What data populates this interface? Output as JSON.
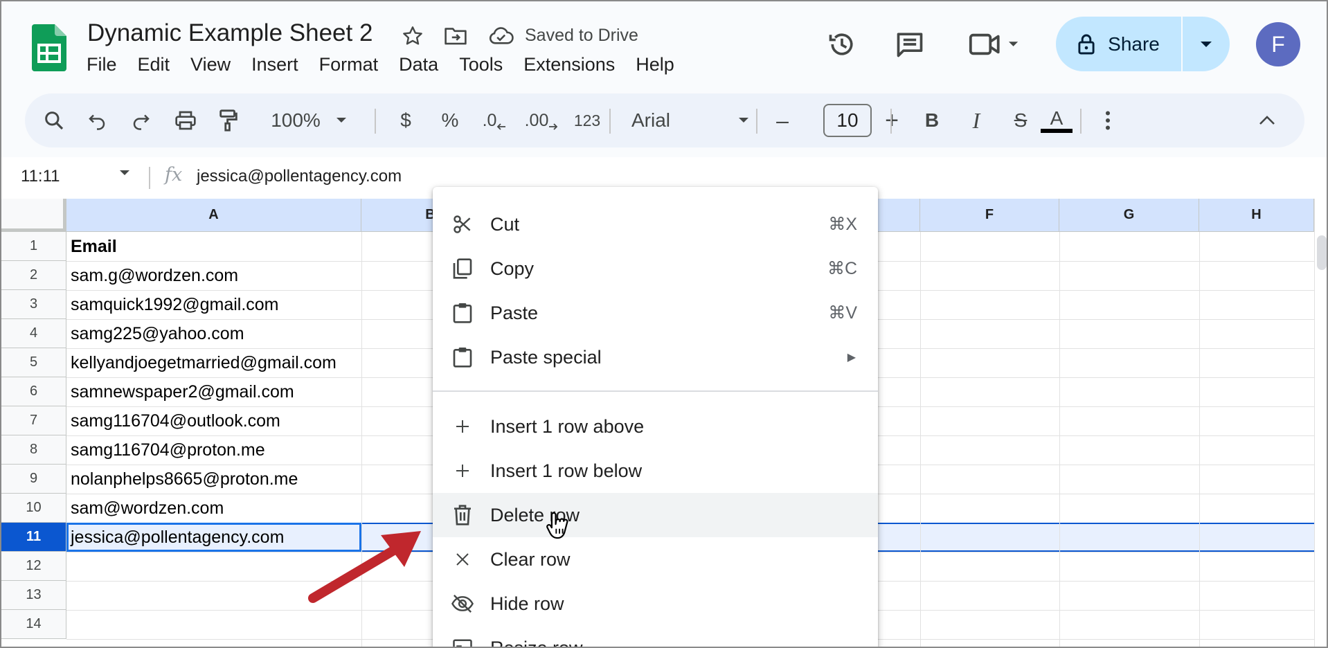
{
  "doc": {
    "title": "Dynamic Example Sheet 2",
    "saved_status": "Saved to Drive"
  },
  "menubar": [
    "File",
    "Edit",
    "View",
    "Insert",
    "Format",
    "Data",
    "Tools",
    "Extensions",
    "Help"
  ],
  "header": {
    "share_label": "Share",
    "avatar_letter": "F"
  },
  "toolbar": {
    "zoom": "100%",
    "currency": "$",
    "percent": "%",
    "decrease_decimal": ".0",
    "increase_decimal": ".00",
    "number_format": "123",
    "font_name": "Arial",
    "font_size": "10",
    "minus": "–",
    "plus": "+",
    "bold": "B",
    "italic": "I",
    "strike": "S",
    "text_color": "A"
  },
  "formula_bar": {
    "name_box": "11:11",
    "fx": "fx",
    "value": "jessica@pollentagency.com"
  },
  "grid": {
    "columns": [
      "A",
      "B",
      "F",
      "G",
      "H"
    ],
    "rows": [
      {
        "num": "1",
        "a": "Email"
      },
      {
        "num": "2",
        "a": "sam.g@wordzen.com"
      },
      {
        "num": "3",
        "a": "samquick1992@gmail.com"
      },
      {
        "num": "4",
        "a": "samg225@yahoo.com"
      },
      {
        "num": "5",
        "a": "kellyandjoegetmarried@gmail.com"
      },
      {
        "num": "6",
        "a": "samnewspaper2@gmail.com"
      },
      {
        "num": "7",
        "a": "samg116704@outlook.com"
      },
      {
        "num": "8",
        "a": "samg116704@proton.me"
      },
      {
        "num": "9",
        "a": "nolanphelps8665@proton.me"
      },
      {
        "num": "10",
        "a": "sam@wordzen.com"
      },
      {
        "num": "11",
        "a": "jessica@pollentagency.com"
      },
      {
        "num": "12",
        "a": ""
      },
      {
        "num": "13",
        "a": ""
      },
      {
        "num": "14",
        "a": ""
      }
    ]
  },
  "context_menu": {
    "cut": {
      "label": "Cut",
      "shortcut": "⌘X"
    },
    "copy": {
      "label": "Copy",
      "shortcut": "⌘C"
    },
    "paste": {
      "label": "Paste",
      "shortcut": "⌘V"
    },
    "paste_special": {
      "label": "Paste special",
      "submenu": "▶"
    },
    "insert_above": {
      "label": "Insert 1 row above"
    },
    "insert_below": {
      "label": "Insert 1 row below"
    },
    "delete_row": {
      "label": "Delete row"
    },
    "clear_row": {
      "label": "Clear row"
    },
    "hide_row": {
      "label": "Hide row"
    },
    "resize_row": {
      "label": "Resize row"
    }
  },
  "colors": {
    "selection": "#0b57d0",
    "share_bg": "#c2e7ff",
    "annotation_arrow": "#c0272d",
    "sheets_green": "#0f9d58"
  }
}
